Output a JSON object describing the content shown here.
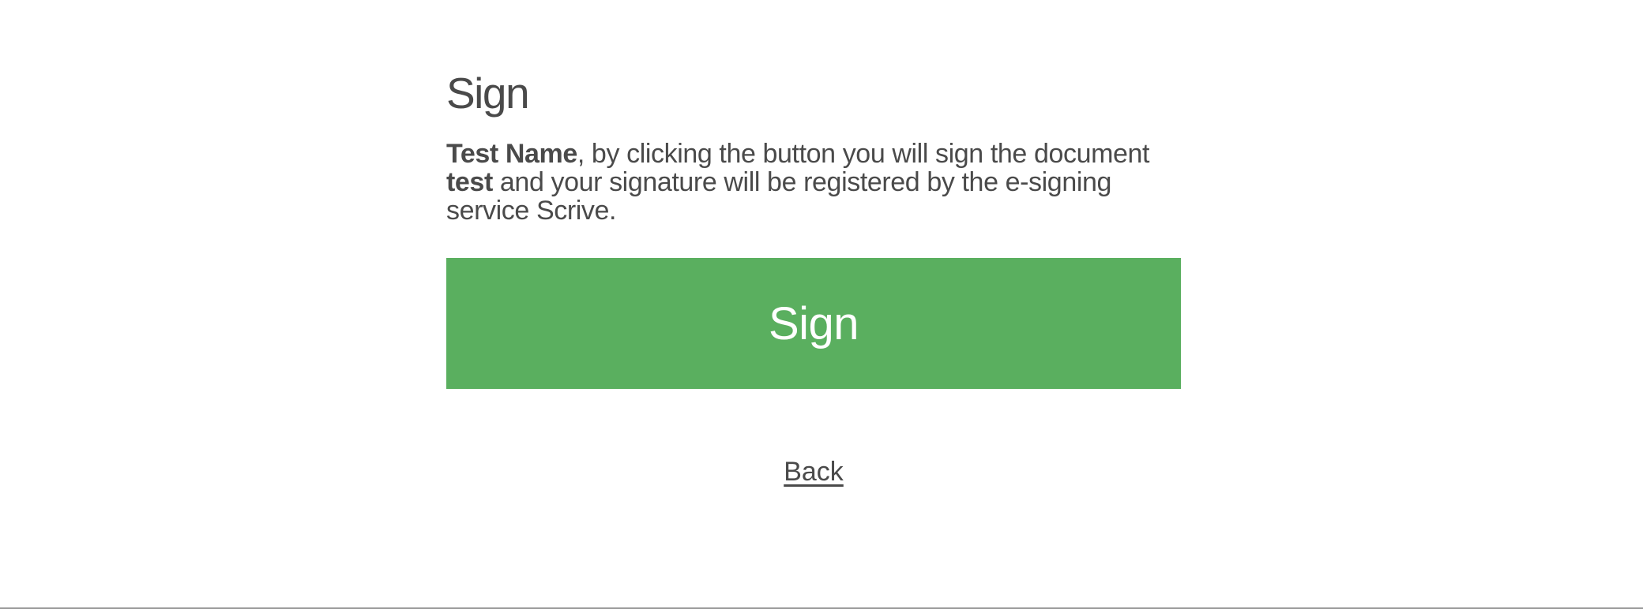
{
  "sign_view": {
    "title": "Sign",
    "message": {
      "signatory_name": "Test Name",
      "part1": ", by clicking the button you will sign the document ",
      "document_name": "test",
      "part2": " and your signature will be registered by the e-signing service Scrive."
    },
    "sign_button_label": "Sign",
    "back_link_label": "Back"
  },
  "colors": {
    "accent": "#5aaf5f",
    "text": "#4a4a4a",
    "background": "#ffffff"
  }
}
